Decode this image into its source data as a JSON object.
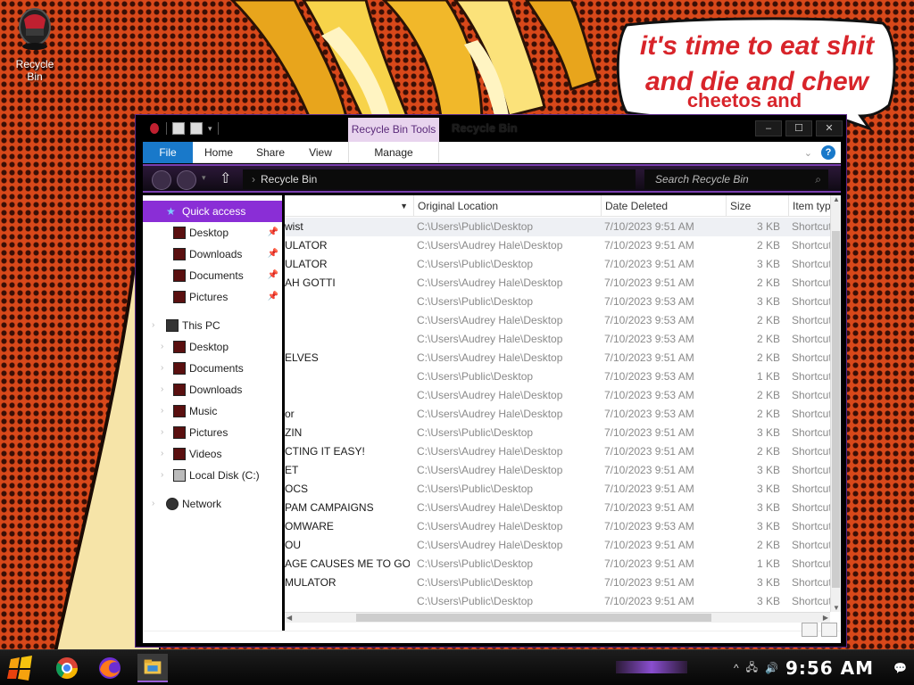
{
  "desktop": {
    "recycle_bin_label": "Recycle Bin",
    "speech_bubble": {
      "line1": "it's time to eat shit",
      "line2": "and die and chew",
      "line3": "cheetos and"
    }
  },
  "window": {
    "title": "Recycle Bin",
    "context_tab": "Recycle Bin Tools",
    "caption": {
      "minimize": "–",
      "maximize": "☐",
      "close": "✕"
    },
    "ribbon_tabs": [
      "File",
      "Home",
      "Share",
      "View",
      "Manage"
    ],
    "address": "Recycle Bin",
    "search_placeholder": "Search Recycle Bin"
  },
  "nav": {
    "quick_access": "Quick access",
    "quick_items": [
      "Desktop",
      "Downloads",
      "Documents",
      "Pictures"
    ],
    "this_pc": "This PC",
    "pc_items": [
      "Desktop",
      "Documents",
      "Downloads",
      "Music",
      "Pictures",
      "Videos",
      "Local Disk (C:)"
    ],
    "network": "Network"
  },
  "table": {
    "columns": {
      "original_location": "Original Location",
      "date_deleted": "Date Deleted",
      "size": "Size",
      "item_type": "Item typ"
    },
    "rows": [
      {
        "name": "wist",
        "location": "C:\\Users\\Public\\Desktop",
        "date": "7/10/2023 9:51 AM",
        "size": "3 KB",
        "type": "Shortcut"
      },
      {
        "name": "ULATOR",
        "location": "C:\\Users\\Audrey Hale\\Desktop",
        "date": "7/10/2023 9:51 AM",
        "size": "2 KB",
        "type": "Shortcut"
      },
      {
        "name": "ULATOR",
        "location": "C:\\Users\\Public\\Desktop",
        "date": "7/10/2023 9:51 AM",
        "size": "3 KB",
        "type": "Shortcut"
      },
      {
        "name": "AH GOTTI",
        "location": "C:\\Users\\Audrey Hale\\Desktop",
        "date": "7/10/2023 9:51 AM",
        "size": "2 KB",
        "type": "Shortcut"
      },
      {
        "name": "",
        "location": "C:\\Users\\Public\\Desktop",
        "date": "7/10/2023 9:53 AM",
        "size": "3 KB",
        "type": "Shortcut"
      },
      {
        "name": "",
        "location": "C:\\Users\\Audrey Hale\\Desktop",
        "date": "7/10/2023 9:53 AM",
        "size": "2 KB",
        "type": "Shortcut"
      },
      {
        "name": "",
        "location": "C:\\Users\\Audrey Hale\\Desktop",
        "date": "7/10/2023 9:53 AM",
        "size": "2 KB",
        "type": "Shortcut"
      },
      {
        "name": "ELVES",
        "location": "C:\\Users\\Audrey Hale\\Desktop",
        "date": "7/10/2023 9:51 AM",
        "size": "2 KB",
        "type": "Shortcut"
      },
      {
        "name": "",
        "location": "C:\\Users\\Public\\Desktop",
        "date": "7/10/2023 9:53 AM",
        "size": "1 KB",
        "type": "Shortcut"
      },
      {
        "name": "",
        "location": "C:\\Users\\Audrey Hale\\Desktop",
        "date": "7/10/2023 9:53 AM",
        "size": "2 KB",
        "type": "Shortcut"
      },
      {
        "name": "or",
        "location": "C:\\Users\\Audrey Hale\\Desktop",
        "date": "7/10/2023 9:53 AM",
        "size": "2 KB",
        "type": "Shortcut"
      },
      {
        "name": "ZIN",
        "location": "C:\\Users\\Public\\Desktop",
        "date": "7/10/2023 9:51 AM",
        "size": "3 KB",
        "type": "Shortcut"
      },
      {
        "name": "CTING IT EASY!",
        "location": "C:\\Users\\Audrey Hale\\Desktop",
        "date": "7/10/2023 9:51 AM",
        "size": "2 KB",
        "type": "Shortcut"
      },
      {
        "name": "ET",
        "location": "C:\\Users\\Audrey Hale\\Desktop",
        "date": "7/10/2023 9:51 AM",
        "size": "3 KB",
        "type": "Shortcut"
      },
      {
        "name": "OCS",
        "location": "C:\\Users\\Public\\Desktop",
        "date": "7/10/2023 9:51 AM",
        "size": "3 KB",
        "type": "Shortcut"
      },
      {
        "name": "PAM CAMPAIGNS",
        "location": "C:\\Users\\Audrey Hale\\Desktop",
        "date": "7/10/2023 9:51 AM",
        "size": "3 KB",
        "type": "Shortcut"
      },
      {
        "name": "OMWARE",
        "location": "C:\\Users\\Audrey Hale\\Desktop",
        "date": "7/10/2023 9:53 AM",
        "size": "3 KB",
        "type": "Shortcut"
      },
      {
        "name": "OU",
        "location": "C:\\Users\\Audrey Hale\\Desktop",
        "date": "7/10/2023 9:51 AM",
        "size": "2 KB",
        "type": "Shortcut"
      },
      {
        "name": "AGE CAUSES ME TO GO IN...",
        "location": "C:\\Users\\Public\\Desktop",
        "date": "7/10/2023 9:51 AM",
        "size": "1 KB",
        "type": "Shortcut"
      },
      {
        "name": "MULATOR",
        "location": "C:\\Users\\Public\\Desktop",
        "date": "7/10/2023 9:51 AM",
        "size": "3 KB",
        "type": "Shortcut"
      },
      {
        "name": "",
        "location": "C:\\Users\\Public\\Desktop",
        "date": "7/10/2023 9:51 AM",
        "size": "3 KB",
        "type": "Shortcut"
      }
    ]
  },
  "taskbar": {
    "clock": "9:56 AM",
    "apps": [
      "start-icon",
      "chrome-icon",
      "firefox-icon",
      "file-explorer-icon"
    ]
  },
  "colors": {
    "accent": "#8a2ed6",
    "file_tab": "#1979ca",
    "bubble_text": "#d8242a"
  }
}
